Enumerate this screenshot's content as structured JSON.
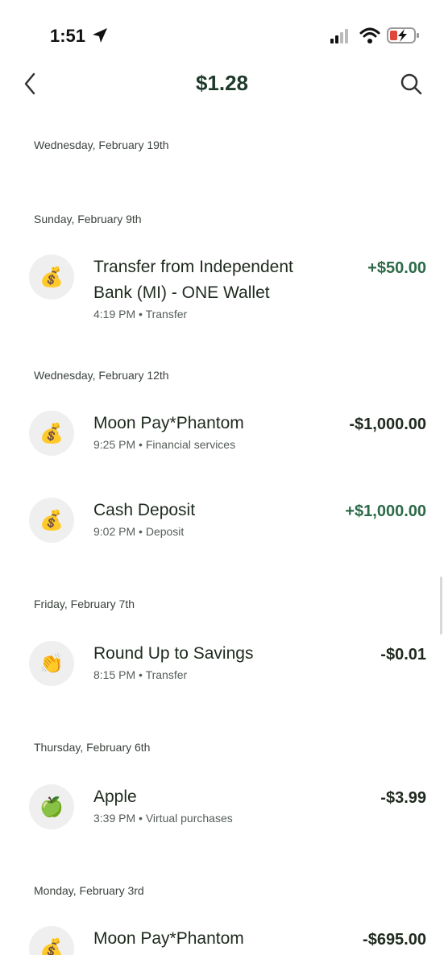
{
  "status_bar": {
    "time": "1:51",
    "icons": [
      "location-arrow-icon",
      "cellular-signal-icon",
      "wifi-icon",
      "battery-charging-icon"
    ]
  },
  "header": {
    "title": "$1.28",
    "back_icon": "chevron-left-icon",
    "search_icon": "search-icon"
  },
  "colors": {
    "positive_amount": "#2d6a48",
    "negative_amount": "#1f2a1f",
    "title": "#1e3a2b",
    "icon_background": "#efefef"
  },
  "groups": [
    {
      "date": "Wednesday, February 19th",
      "transactions": []
    },
    {
      "date": "Sunday, February 9th",
      "transactions": [
        {
          "name": "Transfer from Independent Bank (MI) - ONE Wallet",
          "time": "4:19 PM",
          "category": "Transfer",
          "amount": "+$50.00",
          "icon": "money-bag-icon"
        }
      ]
    },
    {
      "date": "Wednesday, February 12th",
      "transactions": [
        {
          "name": "Moon Pay*Phantom",
          "time": "9:25 PM",
          "category": "Financial services",
          "amount": "-$1,000.00",
          "icon": "money-bag-icon"
        },
        {
          "name": "Cash Deposit",
          "time": "9:02 PM",
          "category": "Deposit",
          "amount": "+$1,000.00",
          "icon": "money-bag-icon"
        }
      ]
    },
    {
      "date": "Friday, February 7th",
      "transactions": [
        {
          "name": "Round Up to Savings",
          "time": "8:15 PM",
          "category": "Transfer",
          "amount": "-$0.01",
          "icon": "clapping-hands-icon"
        }
      ]
    },
    {
      "date": "Thursday, February 6th",
      "transactions": [
        {
          "name": "Apple",
          "time": "3:39 PM",
          "category": "Virtual purchases",
          "amount": "-$3.99",
          "icon": "green-apple-icon"
        }
      ]
    },
    {
      "date": "Monday, February 3rd",
      "transactions": [
        {
          "name": "Moon Pay*Phantom",
          "amount": "-$695.00",
          "icon": "money-bag-icon"
        }
      ]
    }
  ]
}
